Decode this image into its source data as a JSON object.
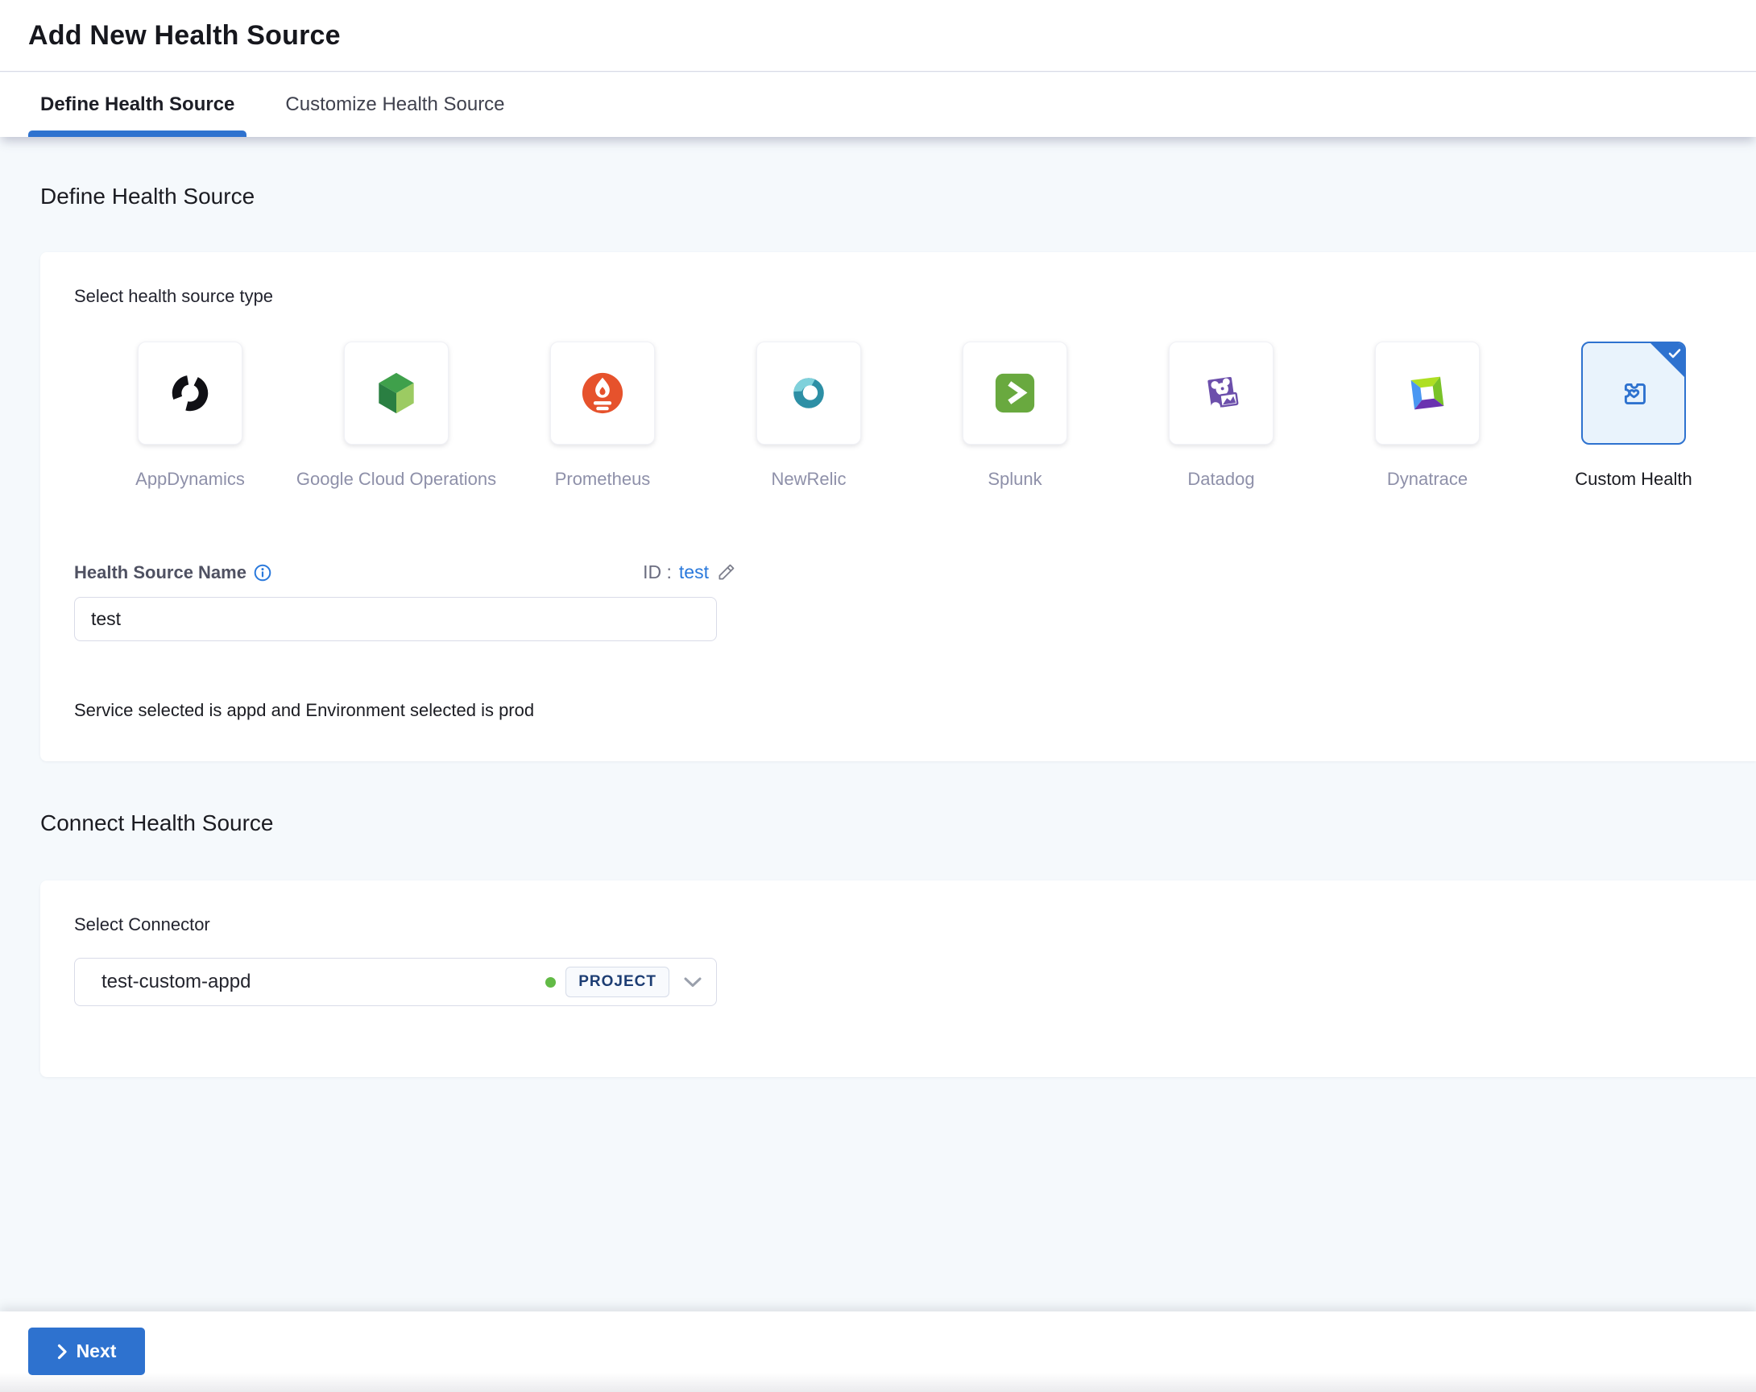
{
  "header": {
    "title": "Add New Health Source"
  },
  "tabs": [
    {
      "label": "Define Health Source",
      "active": true
    },
    {
      "label": "Customize Health Source",
      "active": false
    }
  ],
  "define_section": {
    "title": "Define Health Source",
    "select_type_label": "Select health source type",
    "sources": [
      {
        "name": "AppDynamics",
        "icon": "appdynamics-icon",
        "selected": false
      },
      {
        "name": "Google Cloud Operations",
        "icon": "google-cloud-operations-icon",
        "selected": false
      },
      {
        "name": "Prometheus",
        "icon": "prometheus-icon",
        "selected": false
      },
      {
        "name": "NewRelic",
        "icon": "newrelic-icon",
        "selected": false
      },
      {
        "name": "Splunk",
        "icon": "splunk-icon",
        "selected": false
      },
      {
        "name": "Datadog",
        "icon": "datadog-icon",
        "selected": false
      },
      {
        "name": "Dynatrace",
        "icon": "dynatrace-icon",
        "selected": false
      },
      {
        "name": "Custom Health",
        "icon": "custom-health-icon",
        "selected": true
      }
    ],
    "name_label": "Health Source Name",
    "info_icon": "info-icon",
    "id_label": "ID :",
    "id_value": "test",
    "edit_icon": "edit-pencil-icon",
    "name_value": "test",
    "service_env_text": "Service selected is appd and Environment selected is prod"
  },
  "connect_section": {
    "title": "Connect Health Source",
    "connector_label": "Select Connector",
    "connector_value": "test-custom-appd",
    "connector_status_icon": "green-status-dot",
    "connector_scope": "PROJECT",
    "dropdown_icon": "chevron-down-icon"
  },
  "footer": {
    "next_label": "Next",
    "next_icon": "chevron-right-icon"
  },
  "colors": {
    "primary_blue": "#2e72cf",
    "link_blue": "#2a79dc",
    "page_background": "#f5f9fc",
    "selected_tile_background": "#e9f3fc",
    "tile_label_gray": "#8e90a9",
    "green_status_dot": "#62ba46",
    "badge_text": "#1d3d73"
  }
}
